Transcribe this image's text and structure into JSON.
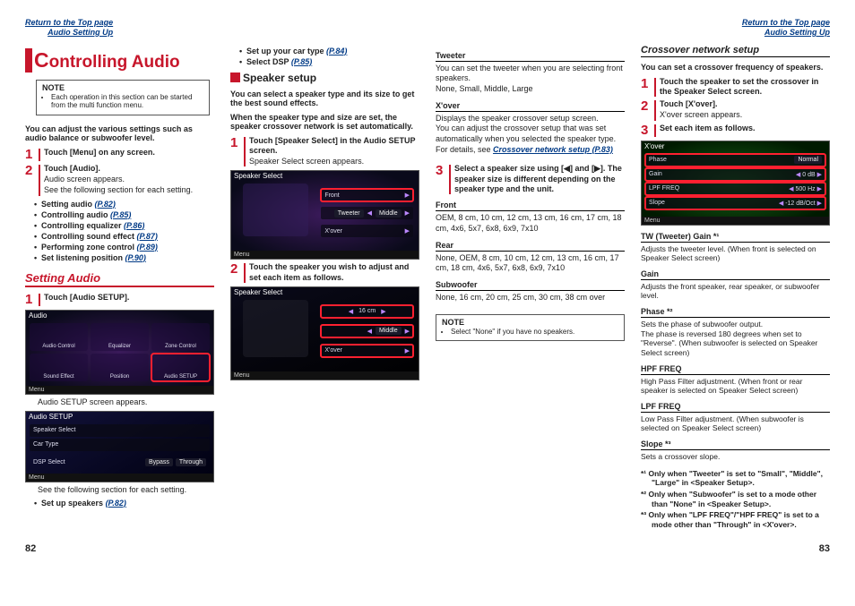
{
  "header": {
    "return_link": "Return to the Top page",
    "section_link": "Audio Setting Up"
  },
  "col1": {
    "title_first": "C",
    "title_rest": "ontrolling Audio",
    "note_label": "NOTE",
    "note_item": "Each operation in this section can be started from the multi function menu.",
    "intro": "You can adjust the various settings such as audio balance or subwoofer level.",
    "step1": "Touch [Menu] on any screen.",
    "step2": "Touch [Audio].",
    "step2_sub1": "Audio screen appears.",
    "step2_sub2": "See the following section for each setting.",
    "bullets": [
      {
        "t": "Setting audio",
        "p": "(P.82)"
      },
      {
        "t": "Controlling audio",
        "p": "(P.85)"
      },
      {
        "t": "Controlling equalizer",
        "p": "(P.86)"
      },
      {
        "t": "Controlling sound effect",
        "p": "(P.87)"
      },
      {
        "t": "Performing zone control",
        "p": "(P.89)"
      },
      {
        "t": "Set listening position",
        "p": "(P.90)"
      }
    ],
    "setting_audio": "Setting Audio",
    "sa_step1": "Touch [Audio SETUP].",
    "sa_caption1": "Audio SETUP screen appears.",
    "sa_caption2": "See the following section for each setting.",
    "sa_bullet": "Set up speakers",
    "sa_bullet_p": "(P.82)",
    "ss1": {
      "title": "Audio",
      "menu": "Menu",
      "cells": [
        "Audio Control",
        "Equalizer",
        "Zone Control",
        "Sound Effect",
        "Position",
        "Audio SETUP"
      ]
    },
    "ss2": {
      "title": "Audio SETUP",
      "menu": "Menu",
      "rows": [
        "Speaker Select",
        "Car Type"
      ],
      "lbl": "DSP Select",
      "b1": "Bypass",
      "b2": "Through"
    }
  },
  "col2": {
    "b1": {
      "t": "Set up your car type",
      "p": "(P.84)"
    },
    "b2": {
      "t": "Select DSP",
      "p": "(P.85)"
    },
    "speaker_setup": "Speaker setup",
    "sp_intro1": "You can select a speaker type and its size to get the best sound effects.",
    "sp_intro2": "When the speaker type and size are set, the speaker crossover network is set automatically.",
    "sp_step1": "Touch [Speaker Select] in the Audio SETUP screen.",
    "sp_step1_sub": "Speaker Select screen appears.",
    "sp_step2": "Touch the speaker you wish to adjust and set each item as follows.",
    "ss3": {
      "title": "Speaker Select",
      "menu": "Menu",
      "row1": "Front",
      "btns1": [
        "Tweeter",
        "Middle"
      ],
      "row2": "X'over"
    },
    "ss4": {
      "title": "Speaker Select",
      "menu": "Menu",
      "sizeLabel": "16 cm",
      "btns": [
        "Middle"
      ],
      "xover": "X'over"
    }
  },
  "col3": {
    "tweeter": {
      "h": "Tweeter",
      "b1": "You can set the tweeter when you are selecting front speakers.",
      "b2": "None, Small, Middle, Large"
    },
    "xover": {
      "h": "X'over",
      "b1": "Displays the speaker crossover setup screen.",
      "b2": "You can adjust the crossover setup that was set automatically when you selected the speaker type.",
      "b3_pre": "For details, see ",
      "b3_link": "Crossover network setup (P.83)"
    },
    "step3": "Select a speaker size using [◀] and [▶]. The speaker size is different depending on the speaker type and the unit.",
    "front": {
      "h": "Front",
      "b": "OEM, 8 cm, 10 cm, 12 cm, 13 cm, 16 cm, 17 cm, 18 cm, 4x6, 5x7, 6x8, 6x9, 7x10"
    },
    "rear": {
      "h": "Rear",
      "b": "None, OEM, 8 cm, 10 cm, 12 cm, 13 cm, 16 cm, 17 cm, 18 cm, 4x6, 5x7, 6x8, 6x9, 7x10"
    },
    "sub": {
      "h": "Subwoofer",
      "b": "None, 16 cm, 20 cm, 25 cm, 30 cm, 38 cm over"
    },
    "note_label": "NOTE",
    "note_item": "Select \"None\" if you have no speakers."
  },
  "col4": {
    "cns": "Crossover network setup",
    "cns_intro": "You can set a crossover frequency of speakers.",
    "step1": "Touch the speaker to set the crossover in the Speaker Select screen.",
    "step2": "Touch [X'over].",
    "step2_sub": "X'over screen appears.",
    "step3": "Set each item as follows.",
    "ss5": {
      "title": "X'over",
      "menu": "Menu",
      "rows": [
        {
          "l": "Phase",
          "v": "Normal"
        },
        {
          "l": "Gain",
          "v": "0 dB"
        },
        {
          "l": "LPF FREQ",
          "v": "500 Hz"
        },
        {
          "l": "Slope",
          "v": "-12 dB/Oct"
        }
      ]
    },
    "twgain": {
      "h": "TW (Tweeter) Gain *¹",
      "b": "Adjusts the tweeter level. (When front is selected on Speaker Select screen)"
    },
    "gain": {
      "h": "Gain",
      "b": "Adjusts the front speaker, rear speaker, or subwoofer level."
    },
    "phase": {
      "h": "Phase *²",
      "b1": "Sets the phase of subwoofer output.",
      "b2": "The phase is reversed 180 degrees when set to \"Reverse\". (When subwoofer is selected on Speaker Select screen)"
    },
    "hpf": {
      "h": "HPF FREQ",
      "b": "High Pass Filter adjustment. (When front or rear speaker is selected on Speaker Select screen)"
    },
    "lpf": {
      "h": "LPF FREQ",
      "b": "Low Pass Filter adjustment. (When subwoofer is selected on Speaker Select screen)"
    },
    "slope": {
      "h": "Slope *³",
      "b": "Sets a crossover slope."
    },
    "fn1": "*¹ Only when \"Tweeter\" is set to \"Small\", \"Middle\", \"Large\" in <Speaker Setup>.",
    "fn2": "*² Only when \"Subwoofer\" is set to a mode other than \"None\" in <Speaker Setup>.",
    "fn3": "*³ Only when \"LPF FREQ\"/\"HPF FREQ\" is set to a mode other than \"Through\" in <X'over>."
  },
  "pages": {
    "left": "82",
    "right": "83"
  }
}
